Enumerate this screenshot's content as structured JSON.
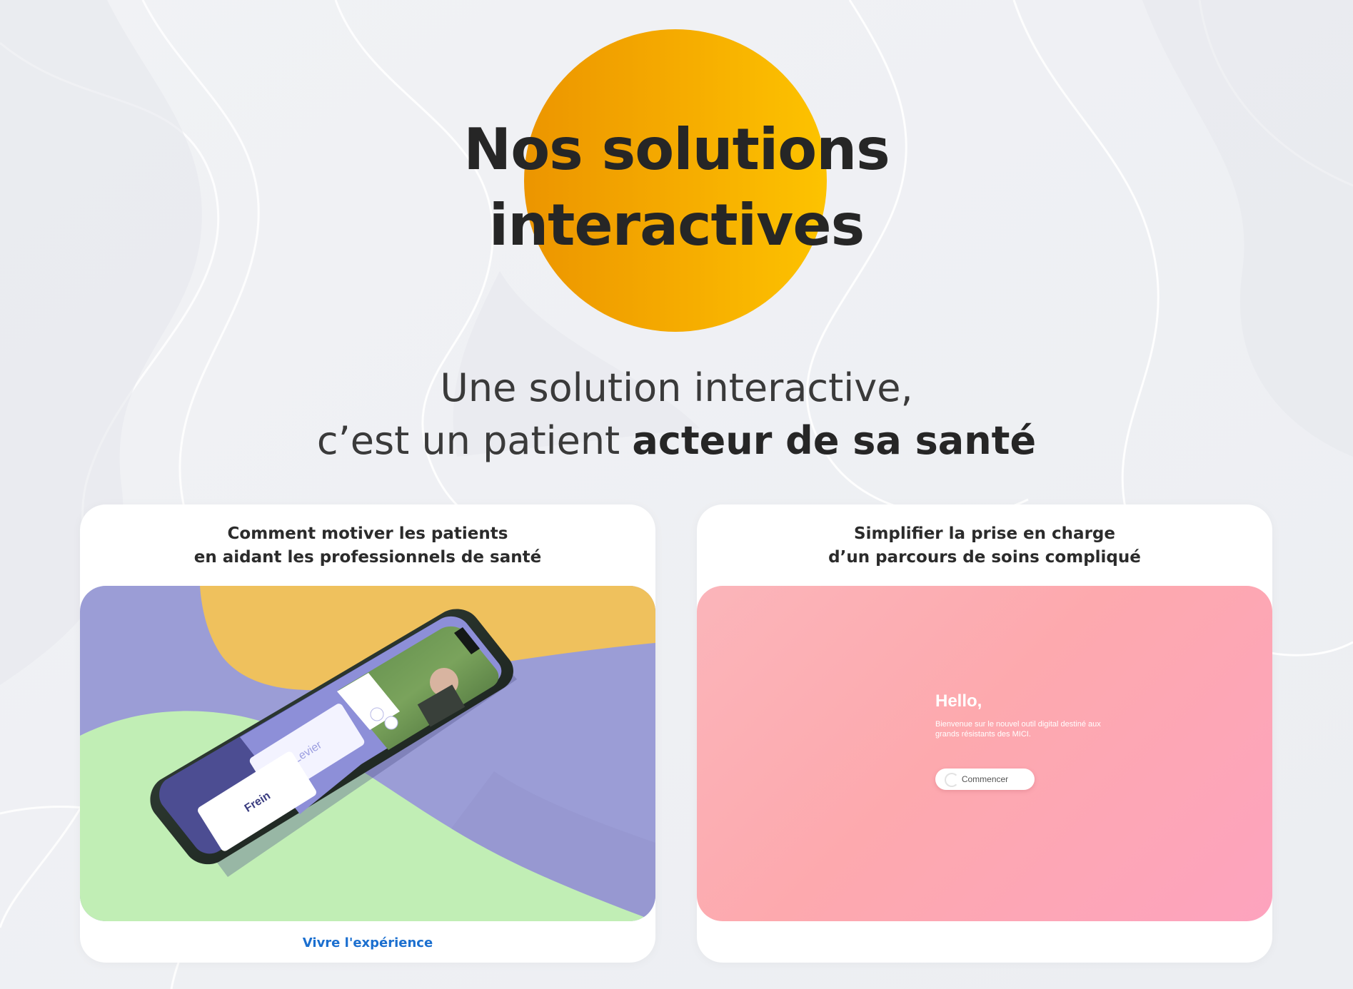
{
  "hero": {
    "title_line1": "Nos solutions",
    "title_line2": "interactives",
    "subtitle_line1": "Une solution interactive,",
    "subtitle_line2_light": "c’est un patient",
    "subtitle_line2_strong": "acteur de sa santé"
  },
  "cards": [
    {
      "title_line1": "Comment motiver les patients",
      "title_line2": "en aidant les professionnels de santé",
      "phone_card_levier": "Levier",
      "phone_card_frein": "Frein",
      "link_label": "Vivre l'expérience"
    },
    {
      "title_line1": "Simplifier la prise en charge",
      "title_line2": "d’un parcours de soins compliqué",
      "screen_hello": "Hello,",
      "screen_welcome": "Bienvenue sur le nouvel outil digital destiné aux grands résistants des MICI.",
      "screen_button": "Commencer"
    }
  ],
  "colors": {
    "accent_yellow": "#f6ad00",
    "link_blue": "#1b6fcf",
    "text_dark": "#262626"
  }
}
